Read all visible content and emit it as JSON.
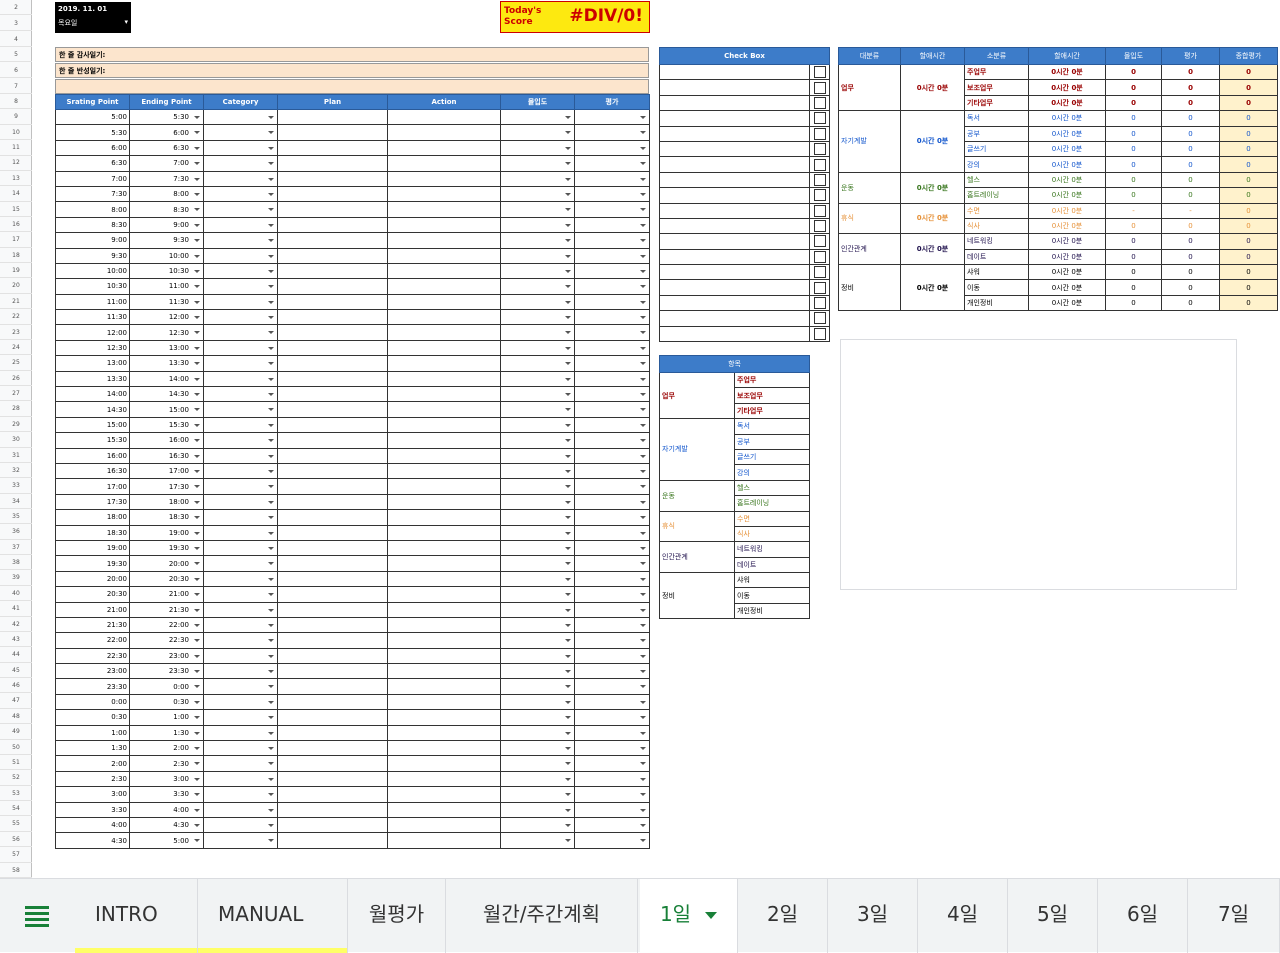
{
  "colors": {
    "accent": "#3d7cc9",
    "score_bg": "#fde910",
    "score_text": "#cc0000",
    "journal_bg": "#fce5cd",
    "total_bg": "#fff2cc",
    "active_tab": "#188038",
    "tab_yellow": "#ffff66"
  },
  "row_numbers": [
    "2",
    "3",
    "4",
    "5",
    "6",
    "7",
    "8",
    "9",
    "10",
    "11",
    "12",
    "13",
    "14",
    "15",
    "16",
    "17",
    "18",
    "19",
    "20",
    "21",
    "22",
    "23",
    "24",
    "25",
    "26",
    "27",
    "28",
    "29",
    "30",
    "31",
    "32",
    "33",
    "34",
    "35",
    "36",
    "37",
    "38",
    "39",
    "40",
    "41",
    "42",
    "43",
    "44",
    "45",
    "46",
    "47",
    "48",
    "49",
    "50",
    "51",
    "52",
    "53",
    "54",
    "55",
    "56",
    "57",
    "58"
  ],
  "header": {
    "date": "2019. 11. 01",
    "weekday": "목요일",
    "score_label": "Today's Score",
    "score_value": "#DIV/0!"
  },
  "journal": {
    "gratitude": "한 줄 감사일기:",
    "reflection": "한 줄 반성일기:"
  },
  "schedule": {
    "columns": [
      "Srating Point",
      "Ending Point",
      "Category",
      "Plan",
      "Action",
      "몰입도",
      "평가"
    ],
    "rows": [
      [
        "5:00",
        "5:30"
      ],
      [
        "5:30",
        "6:00"
      ],
      [
        "6:00",
        "6:30"
      ],
      [
        "6:30",
        "7:00"
      ],
      [
        "7:00",
        "7:30"
      ],
      [
        "7:30",
        "8:00"
      ],
      [
        "8:00",
        "8:30"
      ],
      [
        "8:30",
        "9:00"
      ],
      [
        "9:00",
        "9:30"
      ],
      [
        "9:30",
        "10:00"
      ],
      [
        "10:00",
        "10:30"
      ],
      [
        "10:30",
        "11:00"
      ],
      [
        "11:00",
        "11:30"
      ],
      [
        "11:30",
        "12:00"
      ],
      [
        "12:00",
        "12:30"
      ],
      [
        "12:30",
        "13:00"
      ],
      [
        "13:00",
        "13:30"
      ],
      [
        "13:30",
        "14:00"
      ],
      [
        "14:00",
        "14:30"
      ],
      [
        "14:30",
        "15:00"
      ],
      [
        "15:00",
        "15:30"
      ],
      [
        "15:30",
        "16:00"
      ],
      [
        "16:00",
        "16:30"
      ],
      [
        "16:30",
        "17:00"
      ],
      [
        "17:00",
        "17:30"
      ],
      [
        "17:30",
        "18:00"
      ],
      [
        "18:00",
        "18:30"
      ],
      [
        "18:30",
        "19:00"
      ],
      [
        "19:00",
        "19:30"
      ],
      [
        "19:30",
        "20:00"
      ],
      [
        "20:00",
        "20:30"
      ],
      [
        "20:30",
        "21:00"
      ],
      [
        "21:00",
        "21:30"
      ],
      [
        "21:30",
        "22:00"
      ],
      [
        "22:00",
        "22:30"
      ],
      [
        "22:30",
        "23:00"
      ],
      [
        "23:00",
        "23:30"
      ],
      [
        "23:30",
        "0:00"
      ],
      [
        "0:00",
        "0:30"
      ],
      [
        "0:30",
        "1:00"
      ],
      [
        "1:00",
        "1:30"
      ],
      [
        "1:30",
        "2:00"
      ],
      [
        "2:00",
        "2:30"
      ],
      [
        "2:30",
        "3:00"
      ],
      [
        "3:00",
        "3:30"
      ],
      [
        "3:30",
        "4:00"
      ],
      [
        "4:00",
        "4:30"
      ],
      [
        "4:30",
        "5:00"
      ]
    ]
  },
  "checkbox": {
    "title": "Check Box",
    "count": 18
  },
  "summary": {
    "columns": [
      "대분류",
      "할애시간",
      "소분류",
      "할애시간",
      "몰입도",
      "평가",
      "종합평가"
    ],
    "groups": [
      {
        "name": "업무",
        "cls": "c-work",
        "time": "0시간 0분",
        "items": [
          {
            "name": "주업무",
            "time": "0시간 0분",
            "focus": "0",
            "eval": "0",
            "total": "0"
          },
          {
            "name": "보조업무",
            "time": "0시간 0분",
            "focus": "0",
            "eval": "0",
            "total": "0"
          },
          {
            "name": "기타업무",
            "time": "0시간 0분",
            "focus": "0",
            "eval": "0",
            "total": "0"
          }
        ]
      },
      {
        "name": "자기계발",
        "cls": "c-self",
        "time": "0시간 0분",
        "items": [
          {
            "name": "독서",
            "time": "0시간 0분",
            "focus": "0",
            "eval": "0",
            "total": "0"
          },
          {
            "name": "공부",
            "time": "0시간 0분",
            "focus": "0",
            "eval": "0",
            "total": "0"
          },
          {
            "name": "글쓰기",
            "time": "0시간 0분",
            "focus": "0",
            "eval": "0",
            "total": "0"
          },
          {
            "name": "강의",
            "time": "0시간 0분",
            "focus": "0",
            "eval": "0",
            "total": "0"
          }
        ]
      },
      {
        "name": "운동",
        "cls": "c-ex",
        "time": "0시간 0분",
        "items": [
          {
            "name": "헬스",
            "time": "0시간 0분",
            "focus": "0",
            "eval": "0",
            "total": "0"
          },
          {
            "name": "홈트레이닝",
            "time": "0시간 0분",
            "focus": "0",
            "eval": "0",
            "total": "0"
          }
        ]
      },
      {
        "name": "휴식",
        "cls": "c-rest",
        "time": "0시간 0분",
        "items": [
          {
            "name": "수면",
            "time": "0시간 0분",
            "focus": "-",
            "eval": "-",
            "total": "0"
          },
          {
            "name": "식사",
            "time": "0시간 0분",
            "focus": "0",
            "eval": "0",
            "total": "0"
          }
        ]
      },
      {
        "name": "인간관계",
        "cls": "c-rel",
        "time": "0시간 0분",
        "items": [
          {
            "name": "네트워킹",
            "time": "0시간 0분",
            "focus": "0",
            "eval": "0",
            "total": "0"
          },
          {
            "name": "데이트",
            "time": "0시간 0분",
            "focus": "0",
            "eval": "0",
            "total": "0"
          }
        ]
      },
      {
        "name": "정비",
        "cls": "c-etc",
        "time": "0시간 0분",
        "items": [
          {
            "name": "샤워",
            "time": "0시간 0분",
            "focus": "0",
            "eval": "0",
            "total": "0"
          },
          {
            "name": "이동",
            "time": "0시간 0분",
            "focus": "0",
            "eval": "0",
            "total": "0"
          },
          {
            "name": "개인정비",
            "time": "0시간 0분",
            "focus": "0",
            "eval": "0",
            "total": "0"
          }
        ]
      }
    ]
  },
  "category_table": {
    "title": "항목",
    "groups": [
      {
        "name": "업무",
        "cls": "c-work",
        "items": [
          "주업무",
          "보조업무",
          "기타업무"
        ]
      },
      {
        "name": "자기계발",
        "cls": "c-self",
        "items": [
          "독서",
          "공부",
          "글쓰기",
          "강의"
        ]
      },
      {
        "name": "운동",
        "cls": "c-ex",
        "items": [
          "헬스",
          "홈트레이닝"
        ]
      },
      {
        "name": "휴식",
        "cls": "c-rest",
        "items": [
          "수면",
          "식사"
        ]
      },
      {
        "name": "인간관계",
        "cls": "c-rel",
        "items": [
          "네트워킹",
          "데이트"
        ]
      },
      {
        "name": "정비",
        "cls": "c-etc",
        "items": [
          "샤워",
          "이동",
          "개인정비"
        ]
      }
    ]
  },
  "tabs": [
    {
      "label": "INTRO",
      "underline": "#ffff66",
      "active": false
    },
    {
      "label": "MANUAL",
      "underline": "#ffff66",
      "active": false
    },
    {
      "label": "월평가",
      "underline": "",
      "active": false
    },
    {
      "label": "월간/주간계획",
      "underline": "",
      "active": false
    },
    {
      "label": "1일",
      "underline": "",
      "active": true
    },
    {
      "label": "2일",
      "underline": "",
      "active": false
    },
    {
      "label": "3일",
      "underline": "",
      "active": false
    },
    {
      "label": "4일",
      "underline": "",
      "active": false
    },
    {
      "label": "5일",
      "underline": "",
      "active": false
    },
    {
      "label": "6일",
      "underline": "",
      "active": false
    },
    {
      "label": "7일",
      "underline": "",
      "active": false
    }
  ],
  "icons": {
    "menu": "hamburger-menu-icon",
    "dropdown": "chevron-down-icon"
  }
}
